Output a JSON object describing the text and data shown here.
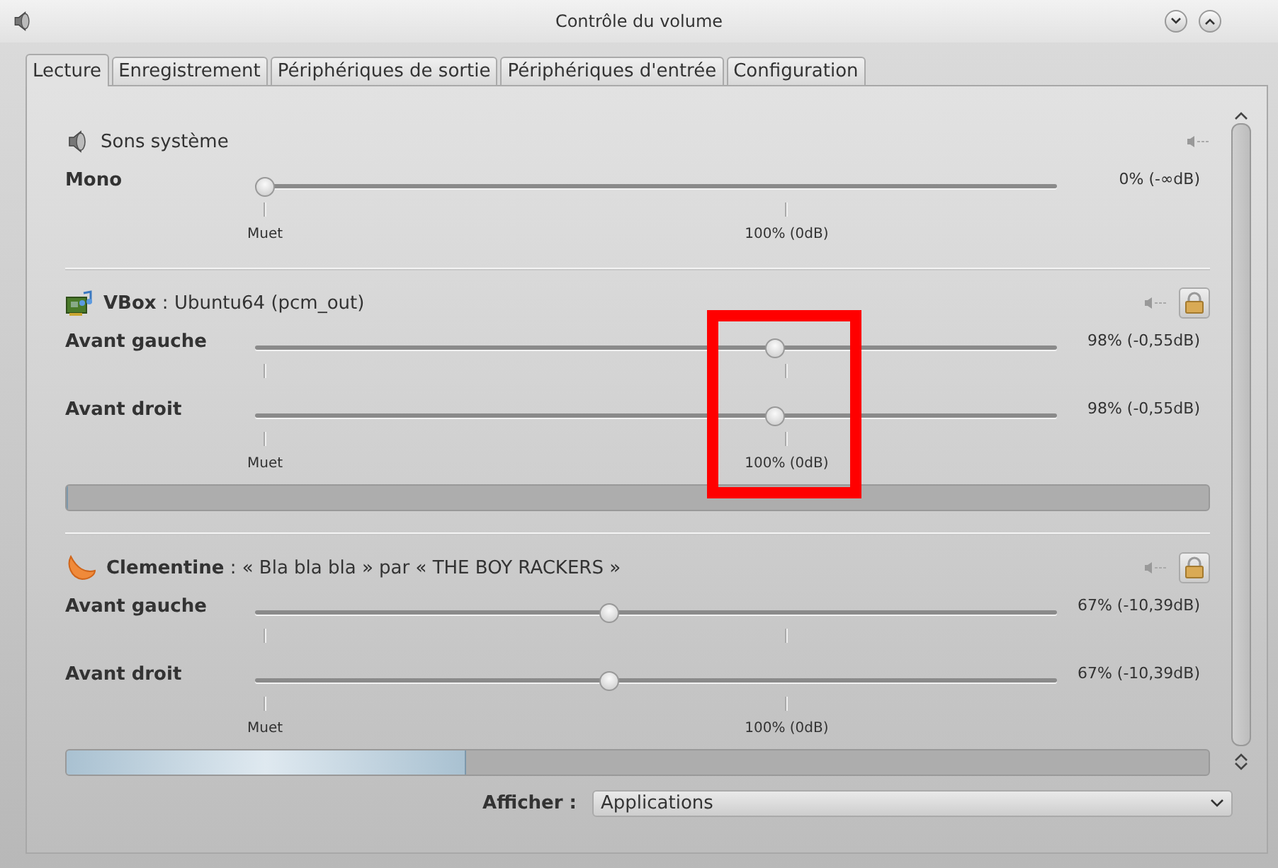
{
  "window": {
    "title": "Contrôle du volume"
  },
  "tabs": [
    {
      "label": "Lecture",
      "selected": true
    },
    {
      "label": "Enregistrement",
      "selected": false
    },
    {
      "label": "Périphériques de sortie",
      "selected": false
    },
    {
      "label": "Périphériques d'entrée",
      "selected": false
    },
    {
      "label": "Configuration",
      "selected": false
    }
  ],
  "streams": [
    {
      "kind": "system",
      "title": "Sons système",
      "lock_button": false,
      "channels": [
        {
          "name": "Mono",
          "level": 0,
          "reading": "0% (-∞dB)"
        }
      ],
      "scale": {
        "min_label": "Muet",
        "mid_label": "100% (0dB)"
      }
    },
    {
      "kind": "device",
      "title": "**VBox** : Ubuntu64 (pcm_out)",
      "lock_button": true,
      "channels": [
        {
          "name": "Avant gauche",
          "level": 0.653,
          "reading": "98% (-0,55dB)"
        },
        {
          "name": "Avant droit",
          "level": 0.653,
          "reading": "98% (-0,55dB)"
        }
      ],
      "scale": {
        "min_label": "Muet",
        "mid_label": "100% (0dB)"
      },
      "meter": {
        "level": 0
      }
    },
    {
      "kind": "player",
      "title": "**Clementine** : « Bla bla bla » par « THE BOY RACKERS »",
      "lock_button": true,
      "channels": [
        {
          "name": "Avant gauche",
          "level": 0.44,
          "reading": "67% (-10,39dB)"
        },
        {
          "name": "Avant droit",
          "level": 0.44,
          "reading": "67% (-10,39dB)"
        }
      ],
      "scale": {
        "min_label": "Muet",
        "mid_label": "100% (0dB)"
      },
      "meter": {
        "level": 0.35
      }
    }
  ],
  "annotation": {
    "shown": true
  },
  "filter": {
    "label": "Afficher :",
    "value": "Applications"
  }
}
